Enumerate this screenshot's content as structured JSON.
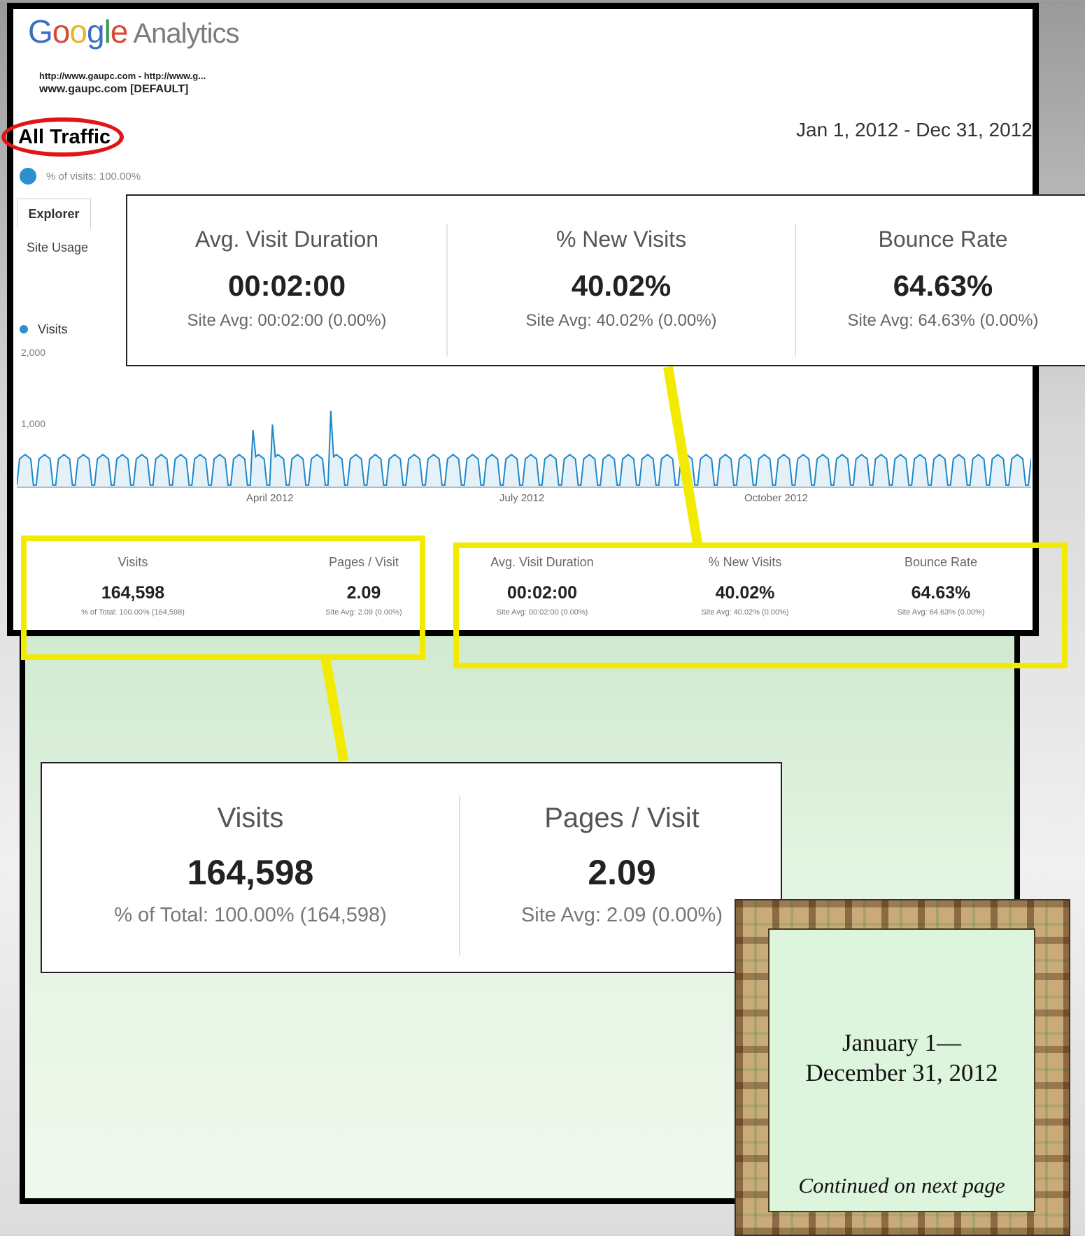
{
  "header": {
    "logo_google": [
      "G",
      "o",
      "o",
      "g",
      "l",
      "e"
    ],
    "logo_product": "Analytics",
    "account_line1": "http://www.gaupc.com - http://www.g...",
    "account_line2": "www.gaupc.com [DEFAULT]",
    "segment_title": "All Traffic",
    "date_range": "Jan 1, 2012 - Dec 31, 2012",
    "segment_detail": "% of visits: 100.00%"
  },
  "tabs": {
    "explorer": "Explorer",
    "site_usage": "Site Usage"
  },
  "colors": {
    "accent": "#2b8fd0",
    "highlight_yellow": "#f2ea00",
    "annotation_red": "#e01515"
  },
  "chart_data": {
    "type": "line",
    "series": [
      {
        "name": "Visits"
      }
    ],
    "y_ticks": [
      "2,000",
      "1,000"
    ],
    "x_ticks": [
      "April 2012",
      "July 2012",
      "October 2012"
    ],
    "ylim": [
      0,
      2000
    ],
    "x_range": [
      "2012-01-01",
      "2012-12-31"
    ],
    "weekly_pattern_visits": {
      "weekday_peak_approx": 600,
      "weekend_low_approx": 0
    },
    "notable_peaks": [
      {
        "date": "2012-03-26",
        "visits": 1050
      },
      {
        "date": "2012-04-02",
        "visits": 1150
      },
      {
        "date": "2012-04-23",
        "visits": 1400
      }
    ]
  },
  "metrics": [
    {
      "label": "Visits",
      "value": "164,598",
      "sub": "% of Total: 100.00% (164,598)"
    },
    {
      "label": "Pages / Visit",
      "value": "2.09",
      "sub": "Site Avg: 2.09 (0.00%)"
    },
    {
      "label": "Avg. Visit Duration",
      "value": "00:02:00",
      "sub": "Site Avg: 00:02:00 (0.00%)"
    },
    {
      "label": "% New Visits",
      "value": "40.02%",
      "sub": "Site Avg: 40.02% (0.00%)"
    },
    {
      "label": "Bounce Rate",
      "value": "64.63%",
      "sub": "Site Avg: 64.63% (0.00%)"
    }
  ],
  "note": {
    "date_line1": "January 1—",
    "date_line2": "December 31, 2012",
    "continued": "Continued on next page"
  }
}
